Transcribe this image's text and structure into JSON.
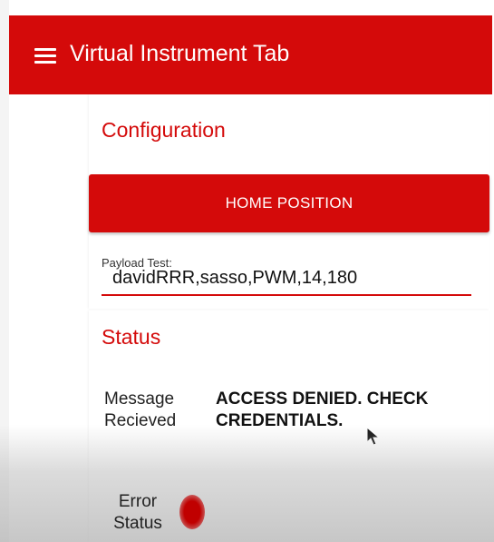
{
  "app_bar": {
    "title": "Virtual Instrument Tab",
    "menu_icon": "hamburger-menu-icon",
    "color": "#d40a0a"
  },
  "configuration": {
    "title": "Configuration",
    "home_button_label": "HOME POSITION",
    "payload_label": "Payload Test:",
    "payload_value": "davidRRR,sasso,PWM,14,180"
  },
  "status": {
    "title": "Status",
    "message_label": "Message Recieved",
    "message_value": "ACCESS DENIED. CHECK CREDENTIALS.",
    "error_label": "Error Status",
    "error_indicator_color": "#c00000"
  },
  "cursor_icon": "mouse-pointer-icon"
}
